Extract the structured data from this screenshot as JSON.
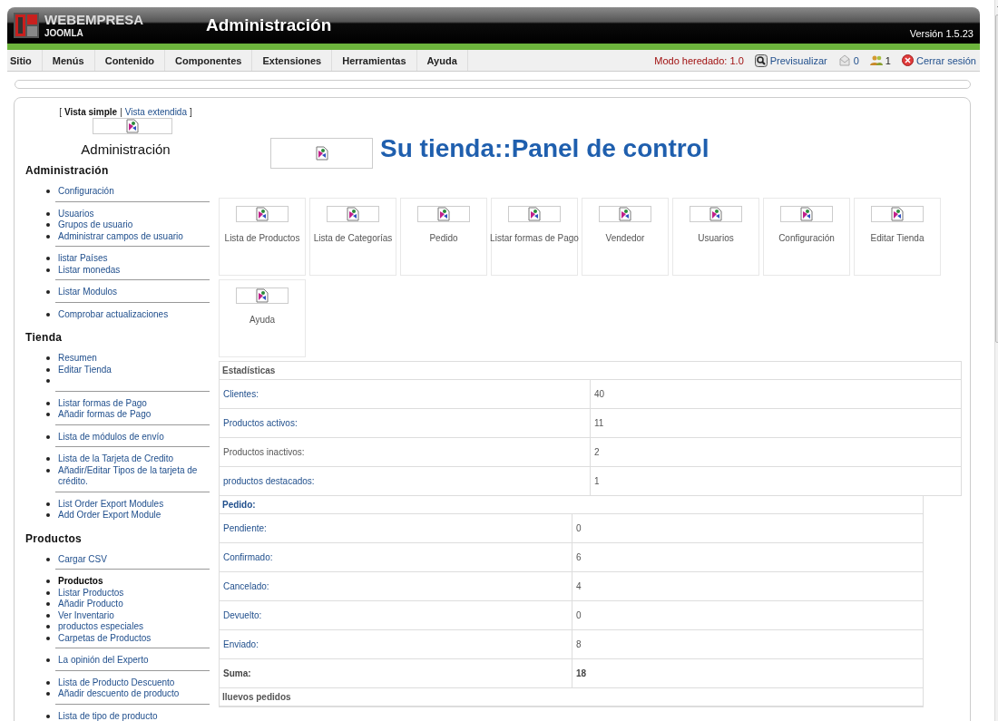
{
  "header": {
    "brand": "WEBEMPRESA",
    "brand_sub": "JOOMLA",
    "title": "Administración",
    "version": "Versión 1.5.23"
  },
  "menu": [
    "Sitio",
    "Menús",
    "Contenido",
    "Componentes",
    "Extensiones",
    "Herramientas",
    "Ayuda"
  ],
  "status_items": [
    {
      "kind": "mode",
      "label": "Modo heredado: 1.0"
    },
    {
      "kind": "preview",
      "label": "Previsualizar"
    },
    {
      "kind": "messages",
      "label": "0"
    },
    {
      "kind": "users",
      "label": "1"
    },
    {
      "kind": "logout",
      "label": "Cerrar sesión"
    }
  ],
  "sidebar": {
    "view_switch": {
      "open": "[",
      "separator": "|",
      "close": "]",
      "options": [
        {
          "label": "Vista simple",
          "selected": true
        },
        {
          "label": "Vista extendida",
          "selected": false
        }
      ]
    },
    "title": "Administración",
    "sections": [
      {
        "title": "Administración",
        "groups": [
          {
            "items": [
              {
                "kind": "link",
                "label": "Configuración"
              }
            ]
          },
          {
            "items": [
              {
                "kind": "link",
                "label": "Usuarios"
              },
              {
                "kind": "link",
                "label": "Grupos de usuario"
              },
              {
                "kind": "link",
                "label": "Administrar campos de usuario"
              }
            ]
          },
          {
            "items": [
              {
                "kind": "link",
                "label": "listar Países"
              },
              {
                "kind": "link",
                "label": "Listar monedas"
              }
            ]
          },
          {
            "items": [
              {
                "kind": "link",
                "label": "Listar Modulos"
              }
            ]
          },
          {
            "items": [
              {
                "kind": "link",
                "label": "Comprobar actualizaciones"
              }
            ]
          }
        ]
      },
      {
        "title": "Tienda",
        "groups": [
          {
            "items": [
              {
                "kind": "link",
                "label": "Resumen"
              },
              {
                "kind": "link",
                "label": "Editar Tienda"
              },
              {
                "kind": "blank"
              }
            ]
          },
          {
            "items": [
              {
                "kind": "link",
                "label": "Listar formas de Pago"
              },
              {
                "kind": "link",
                "label": "Añadir formas de Pago"
              }
            ]
          },
          {
            "items": [
              {
                "kind": "link",
                "label": "Lista de módulos de envío"
              }
            ]
          },
          {
            "items": [
              {
                "kind": "link",
                "label": "Lista de la Tarjeta de Credito"
              },
              {
                "kind": "link",
                "label": "Añadir/Editar Tipos de la tarjeta de crédito."
              }
            ]
          },
          {
            "items": [
              {
                "kind": "link",
                "label": "List Order Export Modules"
              },
              {
                "kind": "link",
                "label": "Add Order Export Module"
              }
            ]
          }
        ]
      },
      {
        "title": "Productos",
        "groups": [
          {
            "items": [
              {
                "kind": "link",
                "label": "Cargar CSV"
              }
            ]
          },
          {
            "items": [
              {
                "kind": "bold",
                "label": "Productos"
              },
              {
                "kind": "link",
                "label": "Listar Productos"
              },
              {
                "kind": "link",
                "label": "Añadir Producto"
              },
              {
                "kind": "link",
                "label": "Ver Inventario"
              },
              {
                "kind": "link",
                "label": "productos especiales"
              },
              {
                "kind": "link",
                "label": "Carpetas de Productos"
              }
            ]
          },
          {
            "items": [
              {
                "kind": "link",
                "label": "La opinión del Experto"
              }
            ]
          },
          {
            "items": [
              {
                "kind": "link",
                "label": "Lista de Producto Descuento"
              },
              {
                "kind": "link",
                "label": "Añadir descuento de producto"
              }
            ]
          },
          {
            "items": [
              {
                "kind": "link",
                "label": "Lista de tipo de producto"
              }
            ]
          }
        ]
      }
    ]
  },
  "panel": {
    "title": "Su tienda::Panel de control",
    "tiles": [
      {
        "label": "Lista de Productos"
      },
      {
        "label": "Lista de Categorías"
      },
      {
        "label": "Pedido"
      },
      {
        "label": "Listar formas de Pago"
      },
      {
        "label": "Vendedor"
      },
      {
        "label": "Usuarios"
      },
      {
        "label": "Configuración"
      },
      {
        "label": "Editar Tienda"
      },
      {
        "label": "Ayuda"
      }
    ],
    "tables": [
      {
        "title": "Estadísticas",
        "kind": "plain",
        "rows": [
          {
            "kind": "link",
            "label": "Clientes:",
            "value": "40"
          },
          {
            "kind": "link",
            "label": "Productos activos:",
            "value": "11"
          },
          {
            "kind": "text",
            "label": "Productos inactivos:",
            "value": "2"
          },
          {
            "kind": "link",
            "label": "productos destacados:",
            "value": "1"
          }
        ]
      },
      {
        "title": "Pedido:",
        "kind": "link",
        "rows": [
          {
            "kind": "link",
            "label": "Pendiente:",
            "value": "0"
          },
          {
            "kind": "link",
            "label": "Confirmado:",
            "value": "6"
          },
          {
            "kind": "link",
            "label": "Cancelado:",
            "value": "4"
          },
          {
            "kind": "link",
            "label": "Devuelto:",
            "value": "0"
          },
          {
            "kind": "link",
            "label": "Enviado:",
            "value": "8"
          },
          {
            "kind": "total",
            "label": "Suma:",
            "value": "18"
          }
        ]
      },
      {
        "title": "lluevos pedidos",
        "kind": "plain"
      }
    ]
  }
}
